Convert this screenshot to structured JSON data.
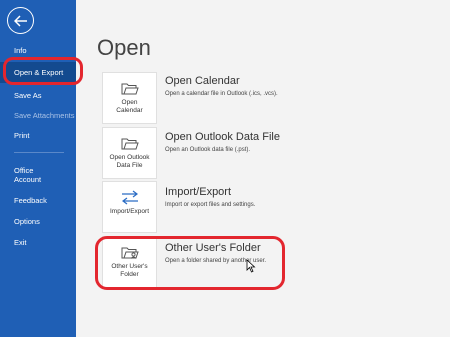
{
  "sidebar": {
    "back_icon": "back-arrow-icon",
    "items": [
      {
        "label": "Info"
      },
      {
        "label": "Open & Export"
      },
      {
        "label": "Save As"
      },
      {
        "label": "Save Attachments"
      },
      {
        "label": "Print"
      },
      {
        "label": "Office\nAccount"
      },
      {
        "label": "Feedback"
      },
      {
        "label": "Options"
      },
      {
        "label": "Exit"
      }
    ]
  },
  "main": {
    "title": "Open",
    "options": [
      {
        "tile_label": "Open\nCalendar",
        "title": "Open Calendar",
        "desc": "Open a calendar file in Outlook (.ics, .vcs).",
        "icon": "open-folder-icon"
      },
      {
        "tile_label": "Open Outlook\nData File",
        "title": "Open Outlook Data File",
        "desc": "Open an Outlook data file (.pst).",
        "icon": "open-folder-icon"
      },
      {
        "tile_label": "Import/Export",
        "title": "Import/Export",
        "desc": "Import or export files and settings.",
        "icon": "import-export-arrows-icon"
      },
      {
        "tile_label": "Other User's\nFolder",
        "title": "Other User's Folder",
        "desc": "Open a folder shared by another user.",
        "icon": "user-folder-icon"
      }
    ]
  },
  "colors": {
    "sidebar": "#1f5fb5",
    "active": "#134a8f",
    "annotation": "#e3262e"
  }
}
